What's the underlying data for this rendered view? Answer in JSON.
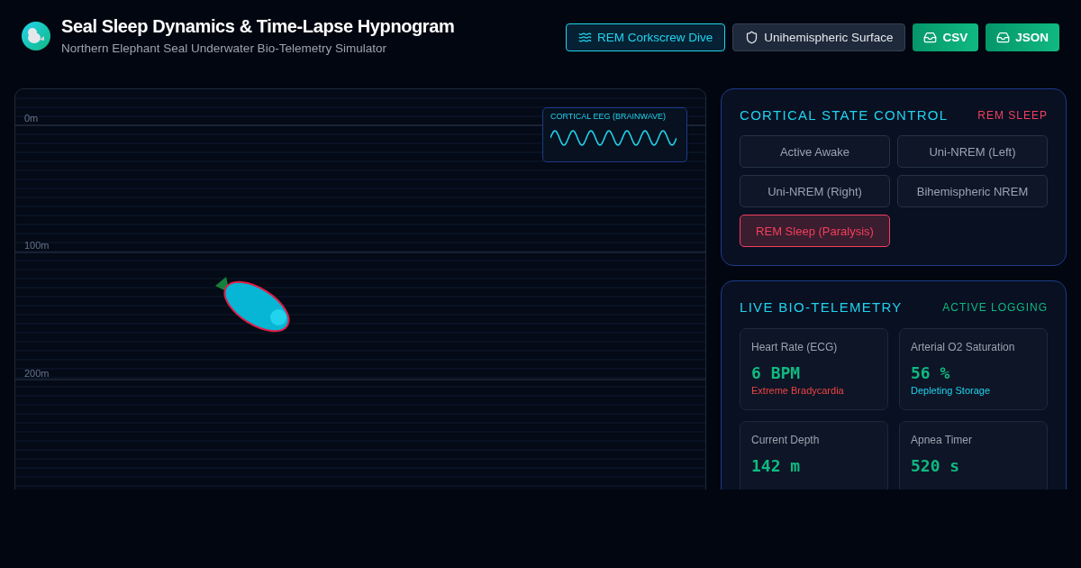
{
  "header": {
    "title": "Seal Sleep Dynamics & Time-Lapse Hypnogram",
    "subtitle": "Northern Elephant Seal Underwater Bio-Telemetry Simulator"
  },
  "modes": [
    {
      "label": "REM Corkscrew Dive",
      "kind": "wave",
      "selected": true
    },
    {
      "label": "Unihemispheric Surface",
      "kind": "shield",
      "selected": false
    }
  ],
  "exports": [
    {
      "label": "CSV"
    },
    {
      "label": "JSON"
    }
  ],
  "scene": {
    "depth_labels": [
      "0m",
      "100m",
      "200m"
    ],
    "eeg": {
      "title": "CORTICAL EEG (BRAINWAVE)"
    }
  },
  "cortical": {
    "title": "CORTICAL STATE CONTROL",
    "status": "REM SLEEP",
    "states": [
      {
        "label": "Active Awake",
        "selected": false
      },
      {
        "label": "Uni-NREM (Left)",
        "selected": false
      },
      {
        "label": "Uni-NREM (Right)",
        "selected": false
      },
      {
        "label": "Bihemispheric NREM",
        "selected": false
      },
      {
        "label": "REM Sleep (Paralysis)",
        "selected": true
      }
    ]
  },
  "telemetry": {
    "title": "LIVE BIO-TELEMETRY",
    "status": "ACTIVE LOGGING",
    "metrics": [
      {
        "label": "Heart Rate (ECG)",
        "value": "6 BPM",
        "note": "Extreme Bradycardia",
        "color": "#ef4444"
      },
      {
        "label": "Arterial O2 Saturation",
        "value": "56 %",
        "note": "Depleting Storage",
        "color": "#22d3ee"
      },
      {
        "label": "Current Depth",
        "value": "142 m"
      },
      {
        "label": "Apnea Timer",
        "value": "520 s"
      }
    ]
  }
}
